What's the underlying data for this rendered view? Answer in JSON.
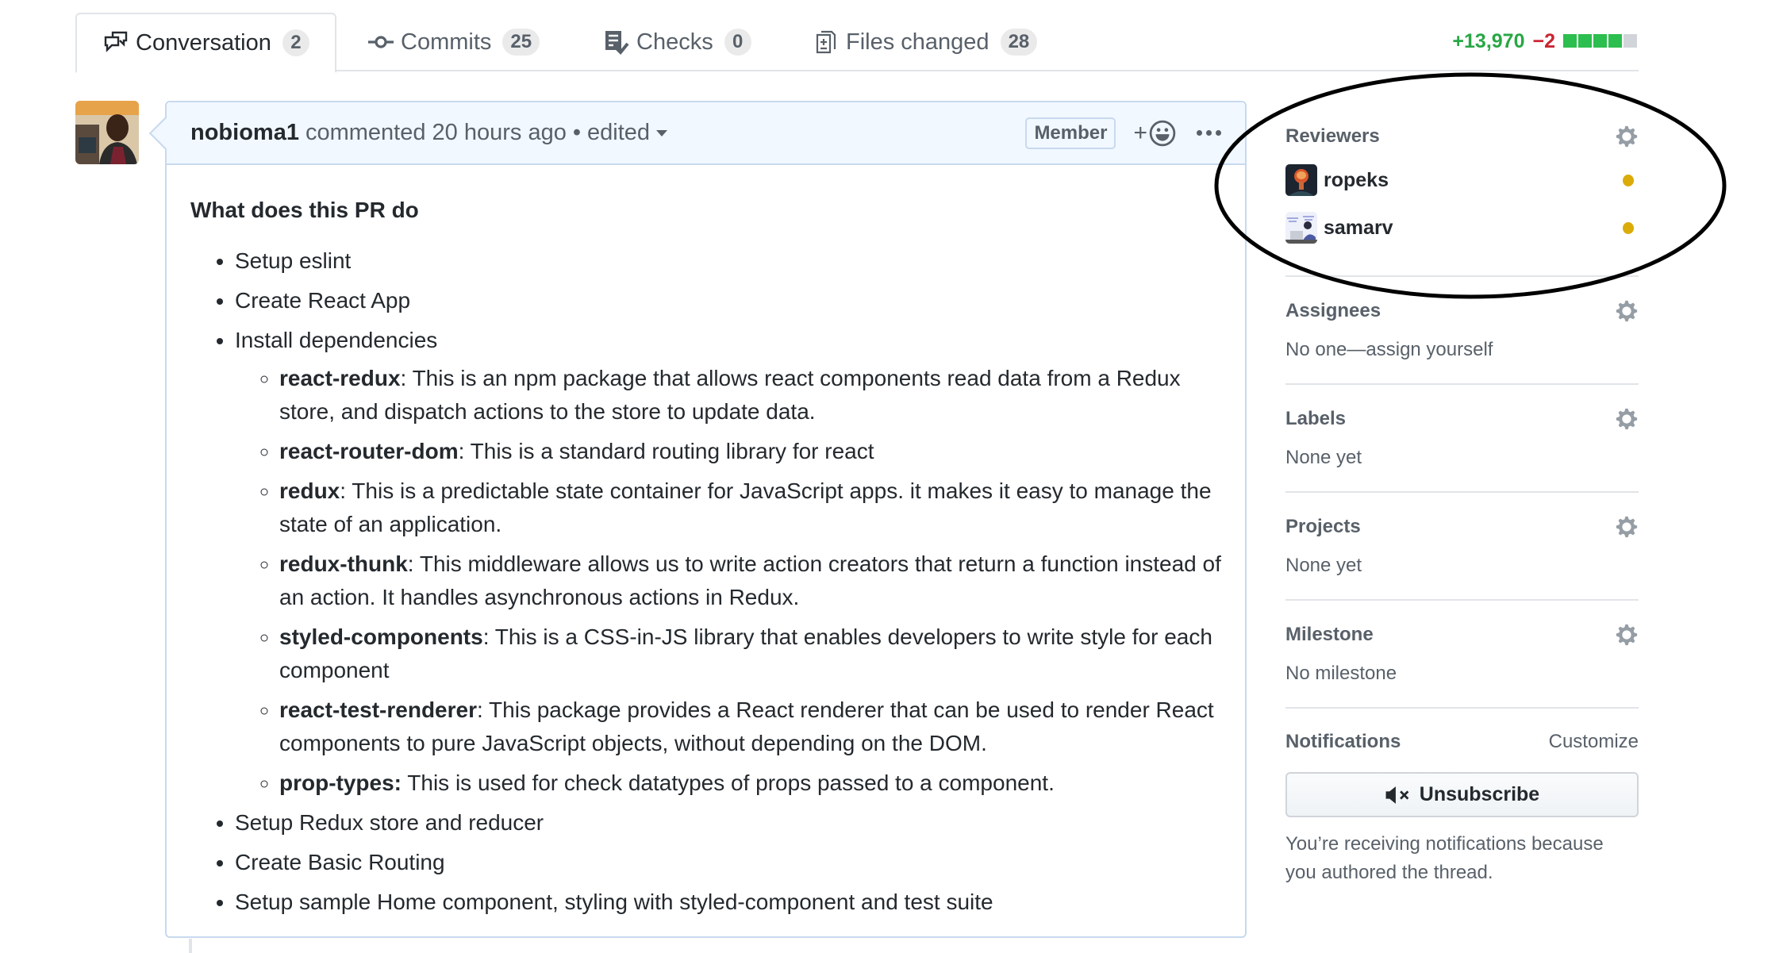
{
  "tabs": [
    {
      "label": "Conversation",
      "count": "2",
      "icon": "comment-discussion-icon",
      "selected": true
    },
    {
      "label": "Commits",
      "count": "25",
      "icon": "git-commit-icon",
      "selected": false
    },
    {
      "label": "Checks",
      "count": "0",
      "icon": "checklist-icon",
      "selected": false
    },
    {
      "label": "Files changed",
      "count": "28",
      "icon": "file-diff-icon",
      "selected": false
    }
  ],
  "diffstat": {
    "additions": "+13,970",
    "deletions": "−2",
    "blocks": [
      "added",
      "added",
      "added",
      "added",
      "neutral"
    ],
    "colors": {
      "added": "#2cbe4e",
      "neutral": "#d1d5da"
    }
  },
  "comment": {
    "author": "nobioma1",
    "action": "commented",
    "time": "20 hours ago",
    "separator": "•",
    "edited": "edited",
    "badge": "Member",
    "reaction_plus": "+",
    "heading": "What does this PR do",
    "items": [
      {
        "text": "Setup eslint"
      },
      {
        "text": "Create React App"
      },
      {
        "text": "Install dependencies",
        "children": [
          {
            "name": "react-redux",
            "desc": ": This is an npm package that allows react components read data from a Redux store, and dispatch actions to the store to update data."
          },
          {
            "name": "react-router-dom",
            "desc": ": This is a standard routing library for react"
          },
          {
            "name": "redux",
            "desc": ": This is a predictable state container for JavaScript apps. it makes it easy to manage the state of an application."
          },
          {
            "name": "redux-thunk",
            "desc": ": This middleware allows us to write action creators that return a function instead of an action. It handles asynchronous actions in Redux."
          },
          {
            "name": "styled-components",
            "desc": ": This is a CSS-in-JS library that enables developers to write style for each component"
          },
          {
            "name": "react-test-renderer",
            "desc": ": This package provides a React renderer that can be used to render React components to pure JavaScript objects, without depending on the DOM."
          },
          {
            "name": "prop-types:",
            "desc": " This is used for check datatypes of props passed to a component."
          }
        ]
      },
      {
        "text": "Setup Redux store and reducer"
      },
      {
        "text": "Create Basic Routing"
      },
      {
        "text": "Setup sample Home component, styling with styled-component and test suite"
      }
    ]
  },
  "sidebar": {
    "reviewers": {
      "heading": "Reviewers",
      "people": [
        {
          "name": "ropeks",
          "status": "pending",
          "status_color": "#dbab09"
        },
        {
          "name": "samarv",
          "status": "pending",
          "status_color": "#dbab09"
        }
      ]
    },
    "assignees": {
      "heading": "Assignees",
      "value": "No one—assign yourself"
    },
    "labels": {
      "heading": "Labels",
      "value": "None yet"
    },
    "projects": {
      "heading": "Projects",
      "value": "None yet"
    },
    "milestone": {
      "heading": "Milestone",
      "value": "No milestone"
    },
    "notifications": {
      "heading": "Notifications",
      "customize": "Customize",
      "button": "Unsubscribe",
      "note": "You’re receiving notifications because you authored the thread."
    }
  }
}
